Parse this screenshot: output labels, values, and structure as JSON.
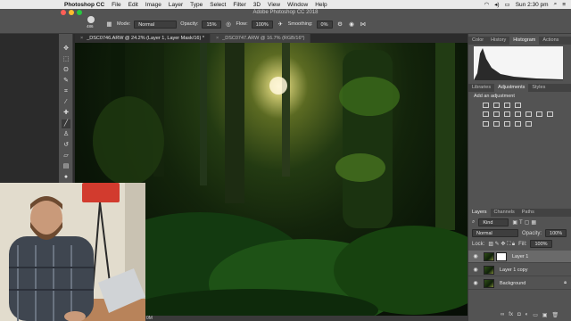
{
  "menubar": {
    "app_name": "Photoshop CC",
    "items": [
      "File",
      "Edit",
      "Image",
      "Layer",
      "Type",
      "Select",
      "Filter",
      "3D",
      "View",
      "Window",
      "Help"
    ],
    "clock": "Sun 2:30 pm"
  },
  "window": {
    "title": "Adobe Photoshop CC 2018"
  },
  "options_bar": {
    "brush_size": "486",
    "mode_label": "Mode:",
    "mode_value": "Normal",
    "opacity_label": "Opacity:",
    "opacity_value": "15%",
    "flow_label": "Flow:",
    "flow_value": "100%",
    "smoothing_label": "Smoothing:",
    "smoothing_value": "0%"
  },
  "document_tabs": [
    {
      "label": "_DSC0746.ARW @ 24.2% (Layer 1, Layer Mask/16) *",
      "active": true
    },
    {
      "label": "_DSC0747.ARW @ 16.7% (RGB/16*)",
      "active": false
    }
  ],
  "status_bar": {
    "text": "0M"
  },
  "panels": {
    "top_tabs": [
      "Color",
      "History",
      "Histogram",
      "Actions"
    ],
    "top_active": "Histogram",
    "mid_tabs": [
      "Libraries",
      "Adjustments",
      "Styles"
    ],
    "mid_active": "Adjustments",
    "adjustments_hint": "Add an adjustment",
    "layers_tabs": [
      "Layers",
      "Channels",
      "Paths"
    ],
    "layers_active": "Layers",
    "kind_filter": "Kind",
    "blend_mode": "Normal",
    "opacity_label": "Opacity:",
    "opacity_value": "100%",
    "lock_label": "Lock:",
    "fill_label": "Fill:",
    "fill_value": "100%",
    "layers": [
      {
        "name": "Layer 1",
        "active": true,
        "has_mask": true
      },
      {
        "name": "Layer 1 copy",
        "active": false,
        "has_mask": false
      },
      {
        "name": "Background",
        "active": false,
        "has_mask": false
      }
    ]
  },
  "colors": {
    "accent_panel": "#535353",
    "menubar": "#e9e9e9",
    "canvas_bg": "#2f2f2f"
  }
}
